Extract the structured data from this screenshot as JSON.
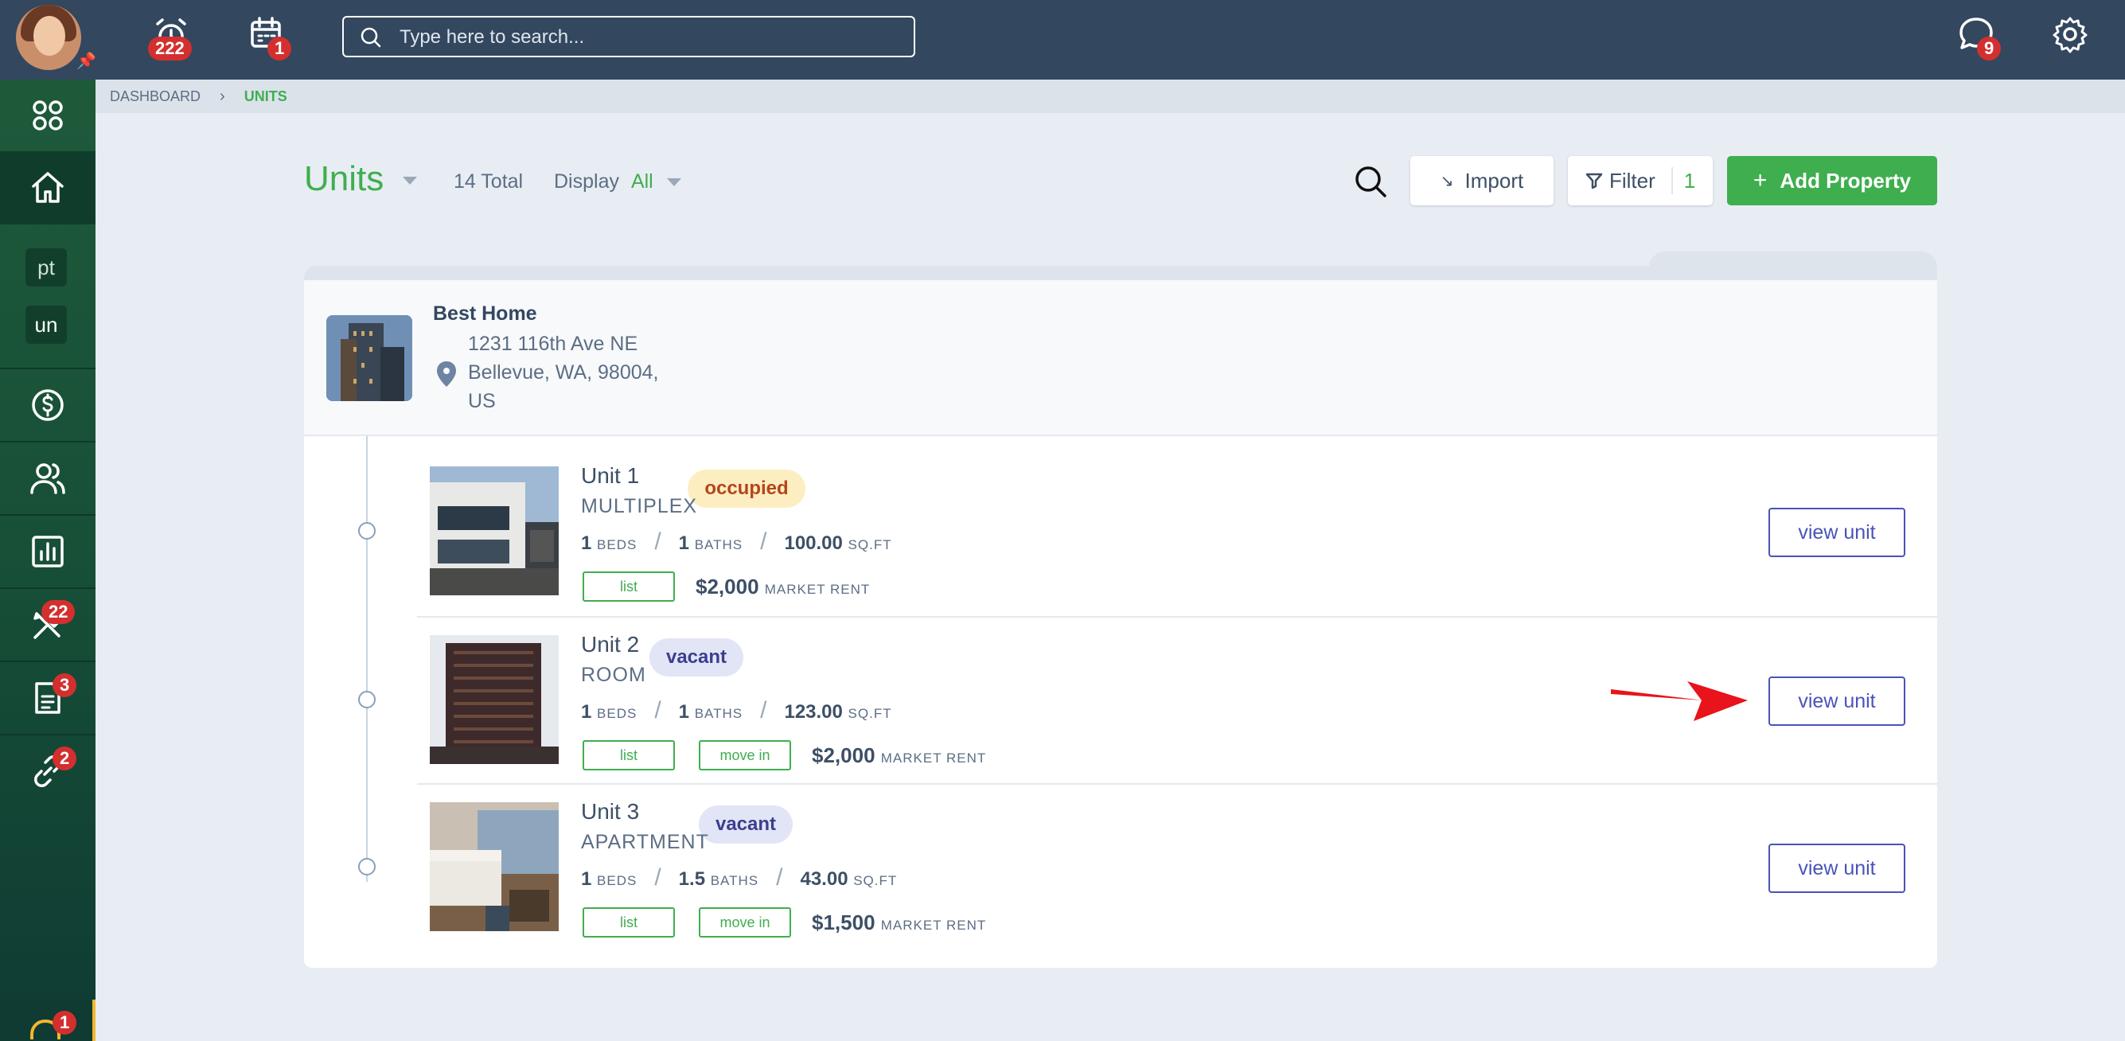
{
  "topbar": {
    "search_placeholder": "Type here to search...",
    "alarm_badge": "222",
    "calendar_badge": "1",
    "messages_badge": "9"
  },
  "sidebar": {
    "items": [
      {
        "name": "apps",
        "icon": "grid-icon"
      },
      {
        "name": "home",
        "icon": "home-icon",
        "active": true
      },
      {
        "name": "pt",
        "abbr": "pt"
      },
      {
        "name": "un",
        "abbr": "un"
      },
      {
        "name": "accounting",
        "icon": "dollar-icon"
      },
      {
        "name": "people",
        "icon": "users-icon"
      },
      {
        "name": "reports",
        "icon": "chart-icon"
      },
      {
        "name": "maintenance",
        "icon": "tools-icon",
        "badge": "22"
      },
      {
        "name": "documents",
        "icon": "document-icon",
        "badge": "3"
      },
      {
        "name": "links",
        "icon": "link-icon",
        "badge": "2"
      }
    ],
    "help_badge": "1"
  },
  "breadcrumb": {
    "root": "DASHBOARD",
    "current": "UNITS"
  },
  "header": {
    "title": "Units",
    "total": "14 Total",
    "display_label": "Display",
    "display_value": "All",
    "import_label": "Import",
    "filter_label": "Filter",
    "filter_count": "1",
    "add_label": "Add Property"
  },
  "property": {
    "name": "Best Home",
    "address_line1": "1231 116th Ave NE",
    "address_line2": "Bellevue, WA, 98004,",
    "address_line3": "US"
  },
  "units": [
    {
      "name": "Unit 1",
      "type": "MULTIPLEX",
      "status": "occupied",
      "beds": "1",
      "baths": "1",
      "sqft": "100.00",
      "rent": "$2,000",
      "chips": [
        "list"
      ]
    },
    {
      "name": "Unit 2",
      "type": "ROOM",
      "status": "vacant",
      "beds": "1",
      "baths": "1",
      "sqft": "123.00",
      "rent": "$2,000",
      "chips": [
        "list",
        "move in"
      ]
    },
    {
      "name": "Unit 3",
      "type": "APARTMENT",
      "status": "vacant",
      "beds": "1",
      "baths": "1.5",
      "sqft": "43.00",
      "rent": "$1,500",
      "chips": [
        "list",
        "move in"
      ]
    }
  ],
  "labels": {
    "beds": "BEDS",
    "baths": "BATHS",
    "sqft": "SQ.FT",
    "market_rent": "MARKET RENT",
    "view_unit": "view unit"
  },
  "colors": {
    "accent": "#3fae4f",
    "topbar": "#33475f",
    "link": "#4a53b8",
    "badge": "#d32f2f"
  }
}
